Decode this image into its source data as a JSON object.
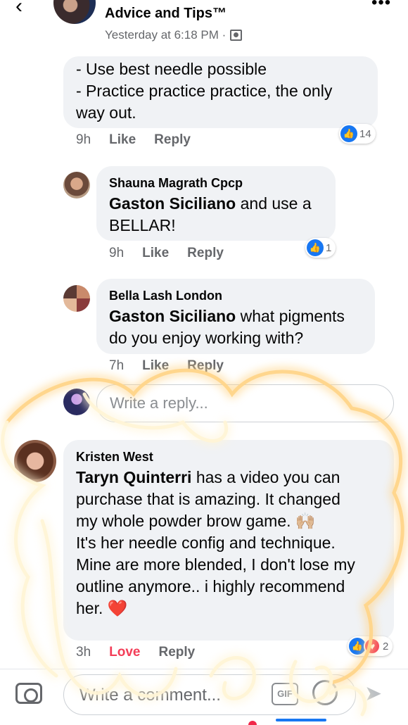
{
  "header": {
    "back_glyph": "‹",
    "title": "Advice and Tips™",
    "subtitle": "Yesterday at 6:18 PM ·",
    "more_glyph": "•••"
  },
  "comment1": {
    "line1": "- Use best needle possible",
    "line2": "- Practice practice practice, the only",
    "line3": "way out.",
    "time": "9h",
    "like": "Like",
    "reply": "Reply",
    "reaction_count": "14"
  },
  "reply1": {
    "author": "Shauna Magrath Cpcp",
    "mention": "Gaston Siciliano",
    "text_rest": " and use a",
    "line2": "BELLAR!",
    "time": "9h",
    "like": "Like",
    "reply": "Reply",
    "reaction_count": "1"
  },
  "reply2": {
    "author": "Bella Lash London",
    "mention": "Gaston Siciliano",
    "text_rest": " what pigments",
    "line2": "do you enjoy working with?",
    "time": "7h",
    "like": "Like",
    "reply": "Reply"
  },
  "reply_input": {
    "placeholder": "Write a reply..."
  },
  "comment2": {
    "author": "Kristen West",
    "mention": "Taryn Quinterri",
    "text_rest": " has a video you can",
    "line2": "purchase that is amazing.  It changed",
    "line3": "my whole powder brow game.",
    "emoji1": "🙌🏼",
    "line4": "It's her needle config and technique.",
    "line5": "Mine are more blended, I don't lose my",
    "line6": "outline anymore.. i highly recommend",
    "line7": "her.",
    "emoji2": "❤️",
    "time": "3h",
    "love": "Love",
    "reply": "Reply",
    "reaction_count": "2"
  },
  "composer": {
    "placeholder": "Write a comment..."
  },
  "colors": {
    "accent": "#1877f2",
    "love": "#f33e58",
    "bubble": "#f0f2f5",
    "glow": "#ffd58a"
  },
  "icons": [
    "back-icon",
    "more-icon",
    "privacy-icon",
    "like-reaction-icon",
    "love-reaction-icon",
    "camera-icon",
    "gif-icon",
    "emoji-icon",
    "send-icon"
  ]
}
